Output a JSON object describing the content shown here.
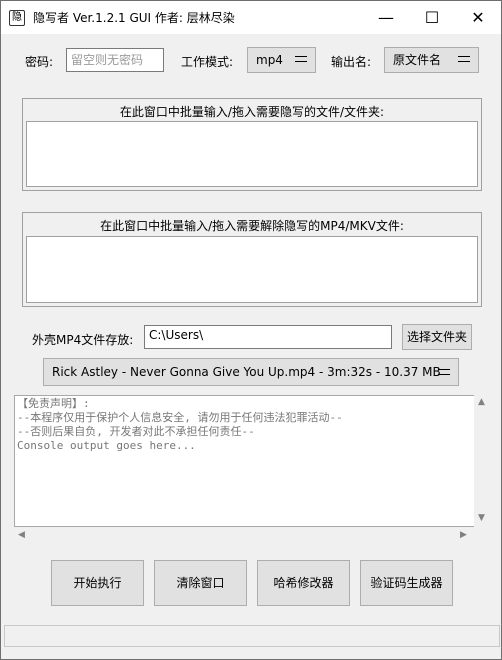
{
  "window": {
    "icon_glyph": "隐",
    "title": "隐写者 Ver.1.2.1 GUI 作者: 层林尽染",
    "minimize_glyph": "—",
    "maximize_glyph": "☐",
    "close_glyph": "✕"
  },
  "settings": {
    "password_label": "密码:",
    "password_placeholder": "留空则无密码",
    "mode_label": "工作模式:",
    "mode_value": "mp4",
    "output_label": "输出名:",
    "output_value": "原文件名"
  },
  "hide_panel": {
    "title": "在此窗口中批量输入/拖入需要隐写的文件/文件夹:"
  },
  "unhide_panel": {
    "title": "在此窗口中批量输入/拖入需要解除隐写的MP4/MKV文件:"
  },
  "shell": {
    "label": "外壳MP4文件存放:",
    "path_value": "C:\\Users\\",
    "browse_button": "选择文件夹",
    "selected_file": "Rick Astley - Never Gonna Give You Up.mp4 - 3m:32s - 10.37 MB"
  },
  "console": {
    "lines": [
      "【免责声明】:",
      "--本程序仅用于保护个人信息安全, 请勿用于任何违法犯罪活动--",
      "--否则后果自负, 开发者对此不承担任何责任--",
      "Console output goes here..."
    ]
  },
  "actions": {
    "start": "开始执行",
    "clear": "清除窗口",
    "hash": "哈希修改器",
    "captcha": "验证码生成器"
  }
}
